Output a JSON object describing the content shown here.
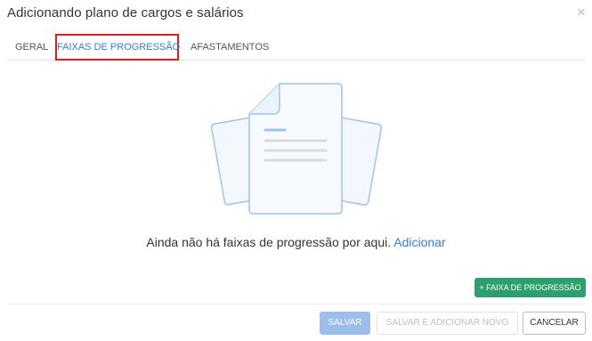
{
  "dialog": {
    "title": "Adicionando plano de cargos e salários",
    "close_glyph": "×"
  },
  "tabs": [
    {
      "label": "GERAL",
      "active": false
    },
    {
      "label": "FAIXAS DE PROGRESSÃO",
      "active": true
    },
    {
      "label": "AFASTAMENTOS",
      "active": false
    }
  ],
  "empty_state": {
    "illustration_icon": "documents-icon",
    "message": "Ainda não há faixas de progressão por aqui.",
    "action_link": "Adicionar"
  },
  "add_band_button": {
    "label": "+ FAIXA DE PROGRESSÃO",
    "color": "#2e9f6e"
  },
  "footer": {
    "save_label": "SALVAR",
    "save_and_new_label": "SALVAR E ADICIONAR NOVO",
    "cancel_label": "CANCELAR"
  },
  "colors": {
    "accent": "#3a7bd5",
    "active_tab_highlight": "#d21f26",
    "save_disabled": "#9dbdeb",
    "success": "#2e9f6e"
  }
}
